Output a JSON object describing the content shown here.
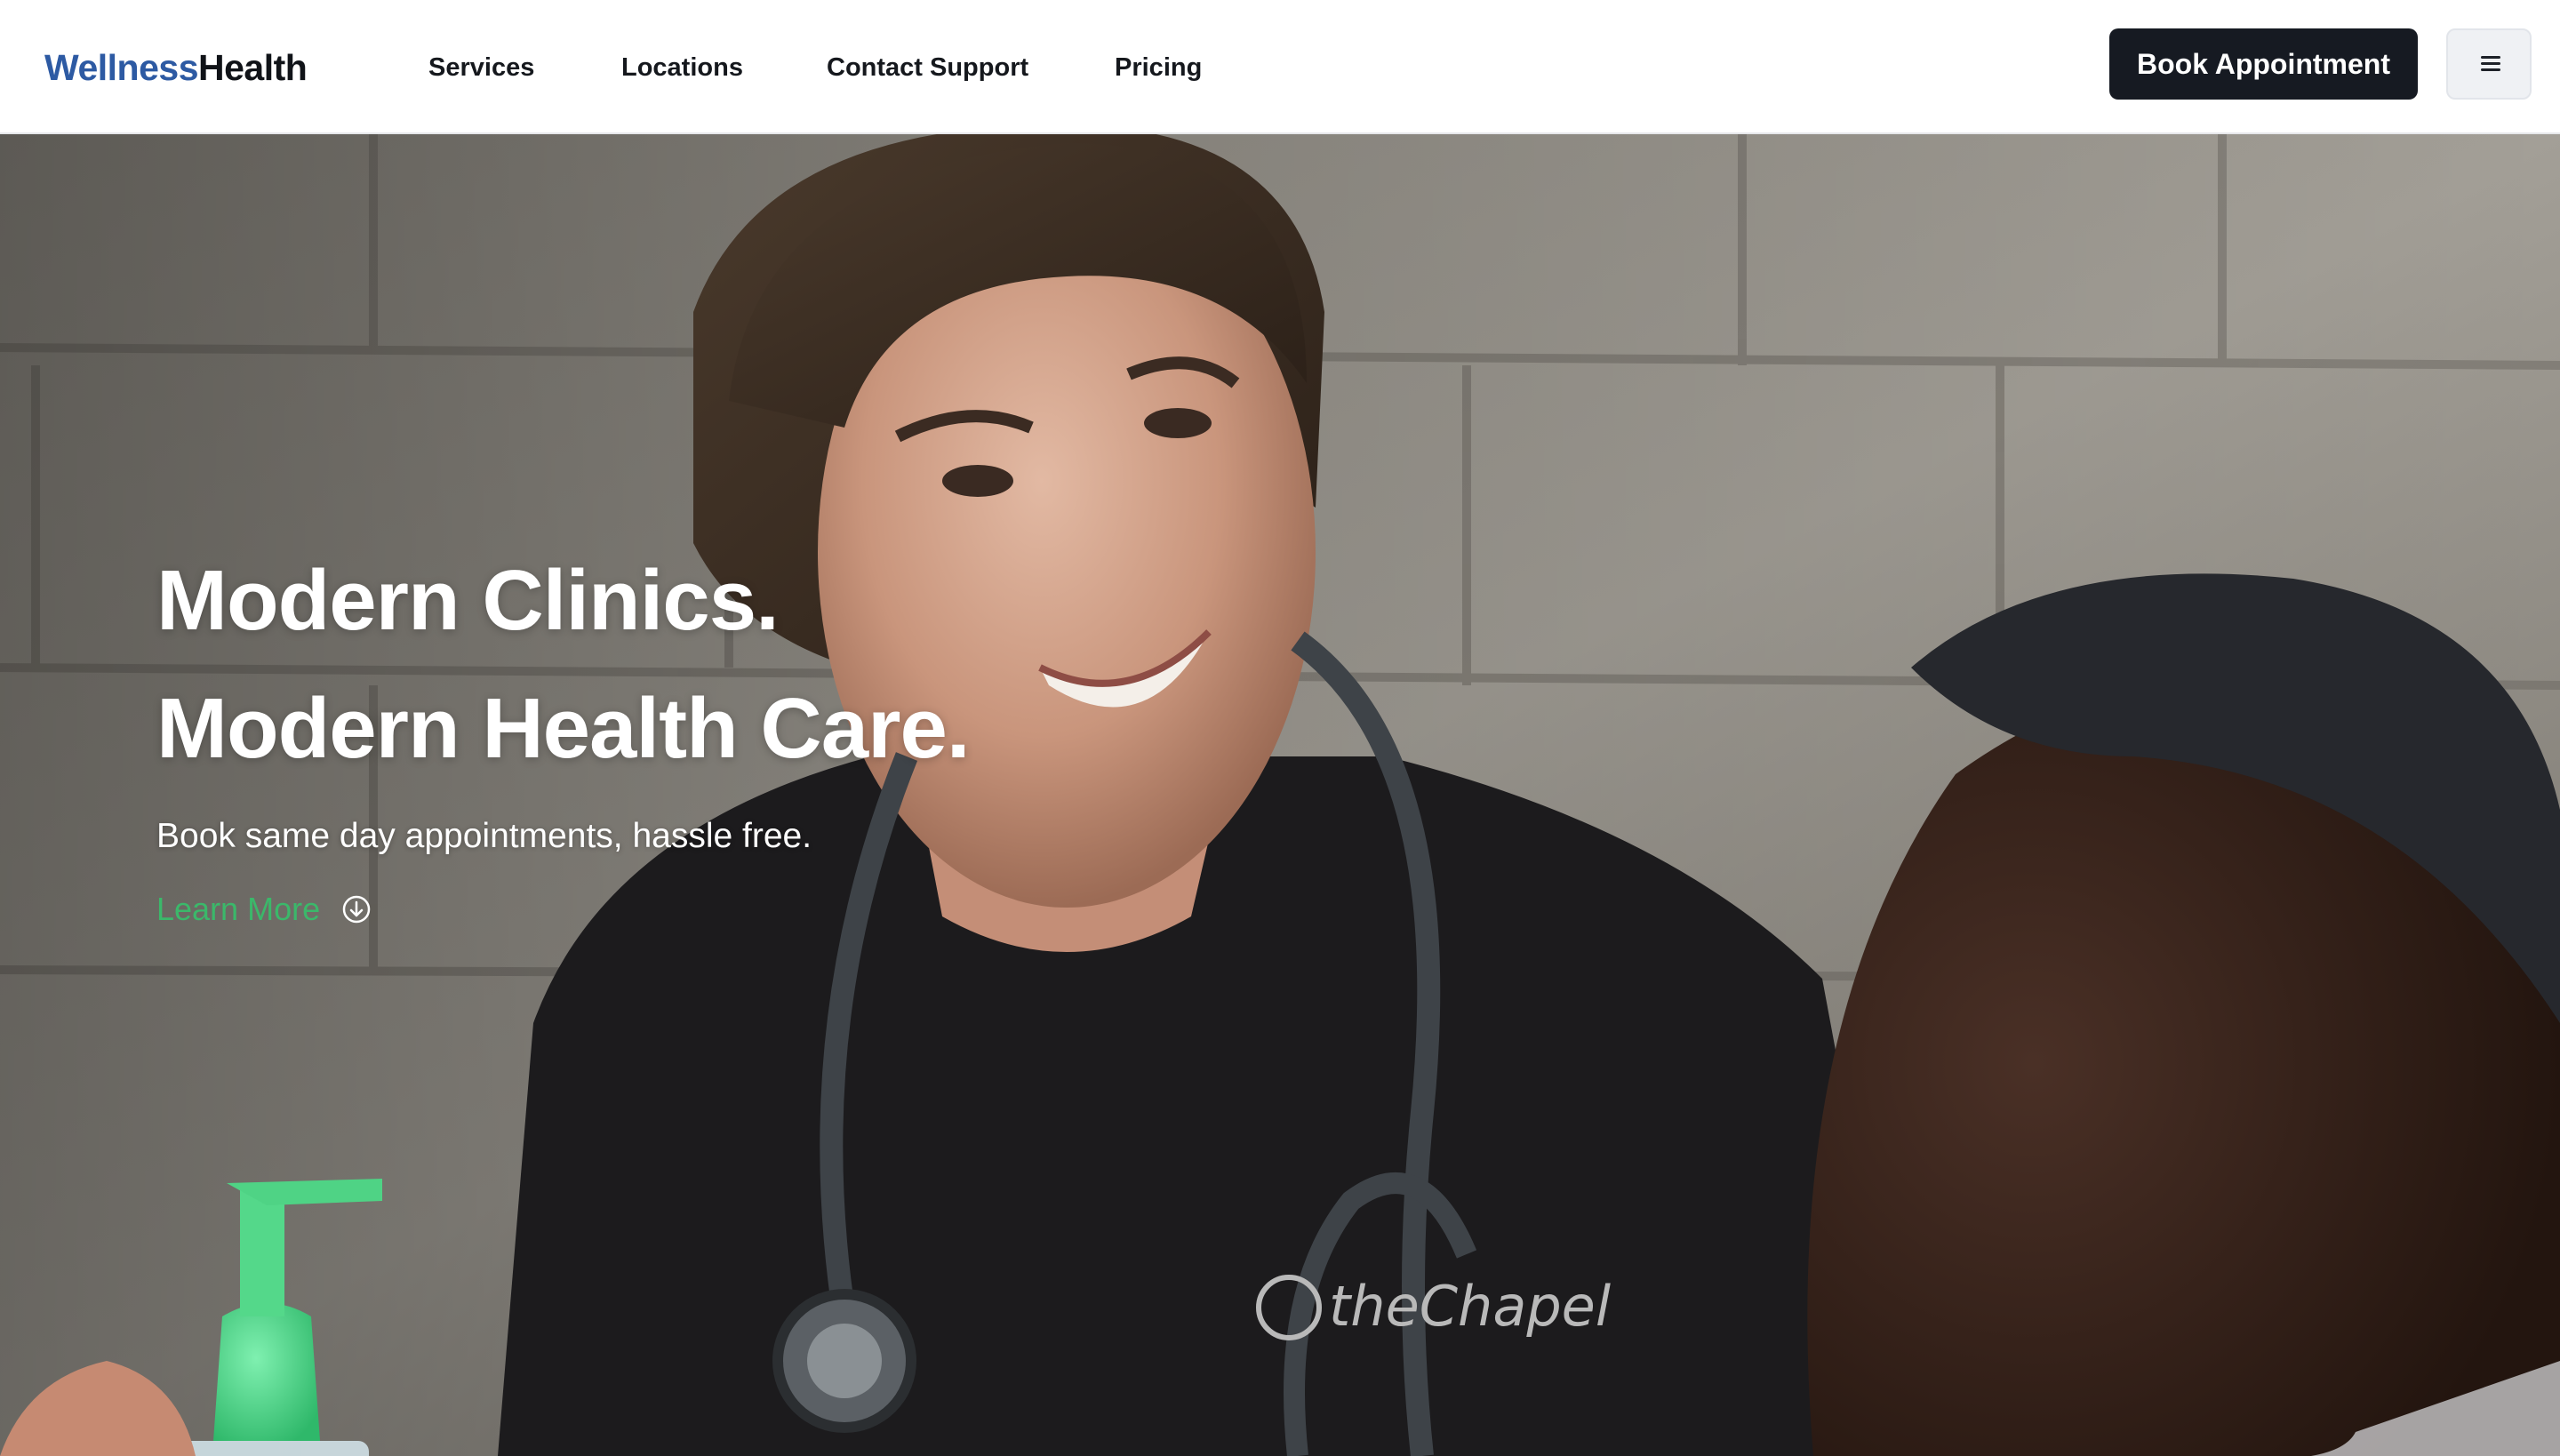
{
  "header": {
    "logo": {
      "part1": "Wellness",
      "part2": "Health"
    },
    "nav": [
      {
        "label": "Services"
      },
      {
        "label": "Locations"
      },
      {
        "label": "Contact Support"
      },
      {
        "label": "Pricing"
      }
    ],
    "cta_label": "Book Appointment",
    "menu_icon": "hamburger-menu-icon"
  },
  "hero": {
    "headline_line1": "Modern Clinics.",
    "headline_line2": "Modern Health Care.",
    "subheadline": "Book same day appointments, hassle free.",
    "learn_more_label": "Learn More",
    "learn_more_icon": "arrow-down-circle-icon",
    "image_description_for_render_only": "",
    "shirt_text": "theChapel"
  },
  "colors": {
    "brand_blue": "#2d5aa3",
    "brand_dark": "#101318",
    "cta_background": "#161a22",
    "accent_green": "#3bb86a",
    "menu_button_bg": "#eff1f4"
  }
}
